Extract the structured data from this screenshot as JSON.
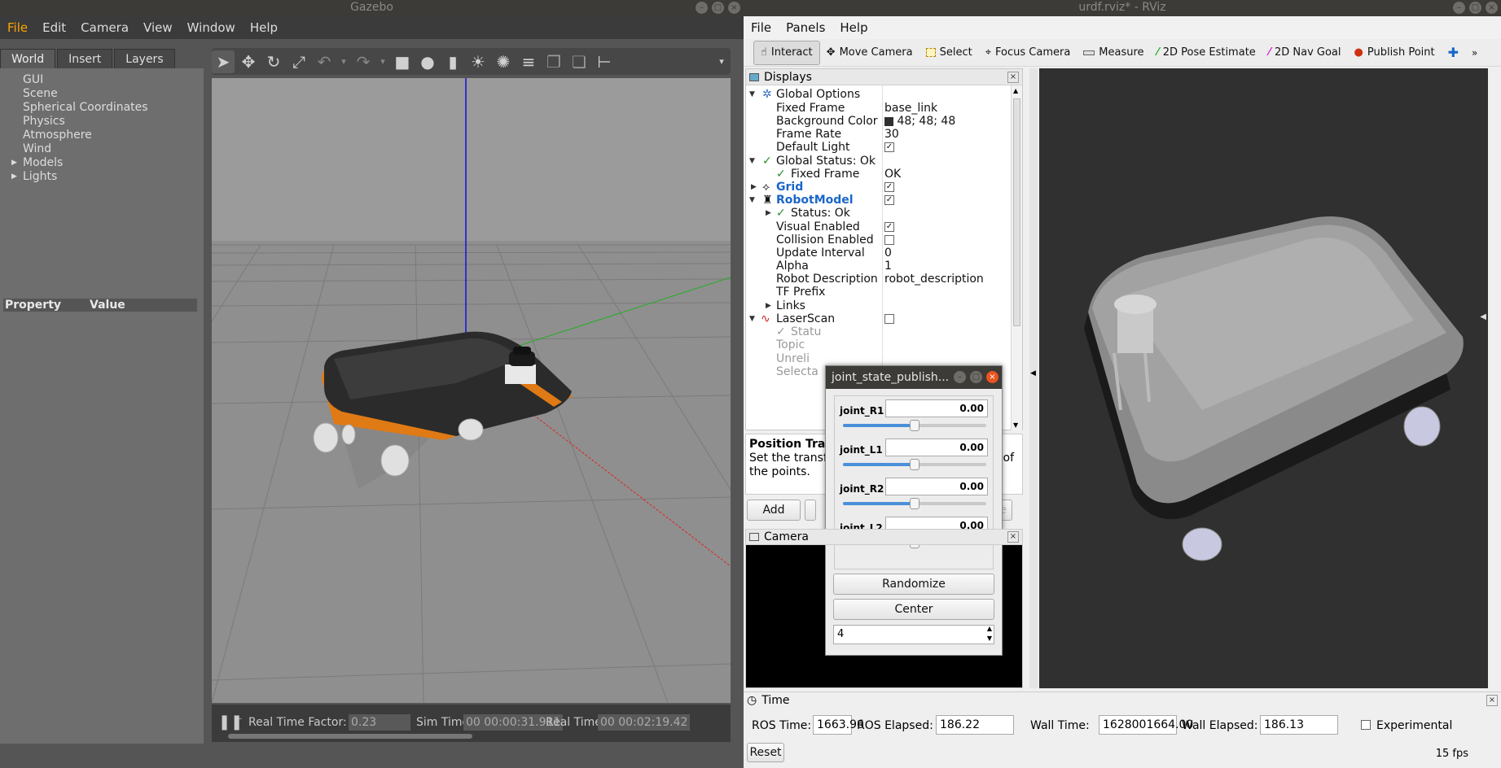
{
  "gazebo": {
    "title": "Gazebo",
    "menu": [
      "File",
      "Edit",
      "Camera",
      "View",
      "Window",
      "Help"
    ],
    "tabs": [
      "World",
      "Insert",
      "Layers"
    ],
    "world_tree": [
      "GUI",
      "Scene",
      "Spherical Coordinates",
      "Physics",
      "Atmosphere",
      "Wind",
      "Models",
      "Lights"
    ],
    "property_header": {
      "property": "Property",
      "value": "Value"
    },
    "status": {
      "rtf_label": "Real Time Factor:",
      "rtf_value": "0.23",
      "sim_label": "Sim Time:",
      "sim_value": "00 00:00:31.911",
      "real_label": "Real Time:",
      "real_value": "00 00:02:19.42"
    }
  },
  "rviz": {
    "title": "urdf.rviz* - RViz",
    "menu": [
      "File",
      "Panels",
      "Help"
    ],
    "tools": [
      "Interact",
      "Move Camera",
      "Select",
      "Focus Camera",
      "Measure",
      "2D Pose Estimate",
      "2D Nav Goal",
      "Publish Point"
    ],
    "displays": {
      "title": "Displays",
      "rows": [
        {
          "name": "Global Options",
          "value": ""
        },
        {
          "name": "Fixed Frame",
          "value": "base_link"
        },
        {
          "name": "Background Color",
          "value": "48; 48; 48"
        },
        {
          "name": "Frame Rate",
          "value": "30"
        },
        {
          "name": "Default Light",
          "value": ""
        },
        {
          "name": "Global Status: Ok",
          "value": ""
        },
        {
          "name": "Fixed Frame",
          "value": "OK"
        },
        {
          "name": "Grid",
          "value": ""
        },
        {
          "name": "RobotModel",
          "value": ""
        },
        {
          "name": "Status: Ok",
          "value": ""
        },
        {
          "name": "Visual Enabled",
          "value": ""
        },
        {
          "name": "Collision Enabled",
          "value": ""
        },
        {
          "name": "Update Interval",
          "value": "0"
        },
        {
          "name": "Alpha",
          "value": "1"
        },
        {
          "name": "Robot Description",
          "value": "robot_description"
        },
        {
          "name": "TF Prefix",
          "value": ""
        },
        {
          "name": "Links",
          "value": ""
        },
        {
          "name": "LaserScan",
          "value": ""
        },
        {
          "name": "Statu",
          "value": ""
        },
        {
          "name": "Topic",
          "value": ""
        },
        {
          "name": "Unreli",
          "value": ""
        },
        {
          "name": "Selecta",
          "value": ""
        }
      ]
    },
    "description": {
      "title": "Position Tran",
      "text_a": "Set the transf",
      "text_b": "of",
      "text_c": "the points."
    },
    "add_button": "Add",
    "partial_button": "e",
    "camera_panel": "Camera",
    "time": {
      "title": "Time",
      "ros_time_label": "ROS Time:",
      "ros_time": "1663.96",
      "ros_elapsed_label": "ROS Elapsed:",
      "ros_elapsed": "186.22",
      "wall_time_label": "Wall Time:",
      "wall_time": "1628001664.00",
      "wall_elapsed_label": "Wall Elapsed:",
      "wall_elapsed": "186.13",
      "experimental": "Experimental",
      "reset": "Reset",
      "fps": "15 fps"
    }
  },
  "jsp": {
    "title": "joint_state_publish...",
    "joints": [
      {
        "name": "joint_R1",
        "value": "0.00",
        "fraction": 0.5
      },
      {
        "name": "joint_L1",
        "value": "0.00",
        "fraction": 0.5
      },
      {
        "name": "joint_R2",
        "value": "0.00",
        "fraction": 0.5
      },
      {
        "name": "joint_L2",
        "value": "0.00",
        "fraction": 0.5
      }
    ],
    "randomize": "Randomize",
    "center": "Center",
    "spin_value": "4"
  },
  "colors": {
    "gazebo_accent": "#ffa500",
    "rviz_link": "#1a66c9",
    "check_green": "#2a8a2a",
    "robot_orange": "#e07a14"
  }
}
